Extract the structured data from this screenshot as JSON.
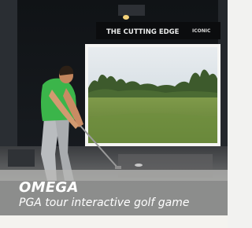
{
  "photo": {
    "banner_text": "THE CUTTING EDGE",
    "banner_brand": "ICONIC"
  },
  "caption": {
    "title": "OMEGA",
    "subtitle": "PGA tour interactive golf game"
  }
}
